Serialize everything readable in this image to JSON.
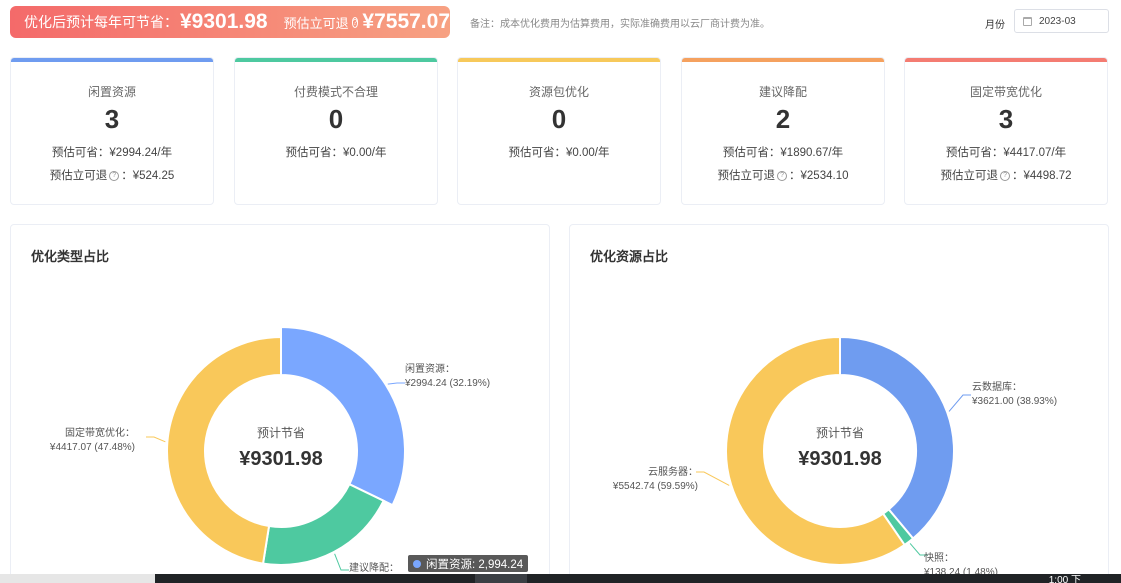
{
  "banner": {
    "annual_label": "优化后预计每年可节省：",
    "annual_value": "¥9301.98",
    "refund_label": "预估立可退",
    "refund_value": "¥7557.07"
  },
  "note": "备注：成本优化费用为估算费用，实际准确费用以云厂商计费为准。",
  "month": {
    "label": "月份",
    "value": "2023-03"
  },
  "cards": [
    {
      "title": "闲置资源",
      "count": "3",
      "line1": "预估可省：¥2994.24/年",
      "line2_label": "预估立可退",
      "line2_value": "：¥524.25",
      "color": "#6f9cf0"
    },
    {
      "title": "付费模式不合理",
      "count": "0",
      "line1": "预估可省：¥0.00/年",
      "line2_label": "",
      "line2_value": "",
      "color": "#4ec9a0"
    },
    {
      "title": "资源包优化",
      "count": "0",
      "line1": "预估可省：¥0.00/年",
      "line2_label": "",
      "line2_value": "",
      "color": "#f7c95b"
    },
    {
      "title": "建议降配",
      "count": "2",
      "line1": "预估可省：¥1890.67/年",
      "line2_label": "预估立可退",
      "line2_value": "：¥2534.10",
      "color": "#f5a15f"
    },
    {
      "title": "固定带宽优化",
      "count": "3",
      "line1": "预估可省：¥4417.07/年",
      "line2_label": "预估立可退",
      "line2_value": "：¥4498.72",
      "color": "#f47c72"
    }
  ],
  "panel_left": {
    "title": "优化类型占比",
    "center_label": "预计节省",
    "center_value": "¥9301.98"
  },
  "panel_right": {
    "title": "优化资源占比",
    "center_label": "预计节省",
    "center_value": "¥9301.98"
  },
  "tooltip": "闲置资源: 2,994.24",
  "chart_data": [
    {
      "type": "pie",
      "title": "优化类型占比",
      "slices": [
        {
          "name": "闲置资源",
          "value": 2994.24,
          "percent": 32.19,
          "color": "#7aa7ff",
          "label1": "闲置资源：",
          "label2": "¥2994.24  (32.19%)"
        },
        {
          "name": "建议降配",
          "value": 1890.67,
          "percent": 20.33,
          "color": "#4ec9a0",
          "label1": "建议降配：",
          "label2": ""
        },
        {
          "name": "固定带宽优化",
          "value": 4417.07,
          "percent": 47.48,
          "color": "#f9c85a",
          "label1": "固定带宽优化：",
          "label2": "¥4417.07  (47.48%)"
        }
      ]
    },
    {
      "type": "pie",
      "title": "优化资源占比",
      "slices": [
        {
          "name": "云数据库",
          "value": 3621.0,
          "percent": 38.93,
          "color": "#6f9cf0",
          "label1": "云数据库：",
          "label2": "¥3621.00  (38.93%)"
        },
        {
          "name": "快照",
          "value": 138.24,
          "percent": 1.48,
          "color": "#4ec9a0",
          "label1": "快照：",
          "label2": "¥138.24  (1.48%)"
        },
        {
          "name": "云服务器",
          "value": 5542.74,
          "percent": 59.59,
          "color": "#f9c85a",
          "label1": "云服务器：",
          "label2": "¥5542.74  (59.59%)"
        }
      ]
    }
  ],
  "taskbar": {
    "time": "1:00 下"
  }
}
